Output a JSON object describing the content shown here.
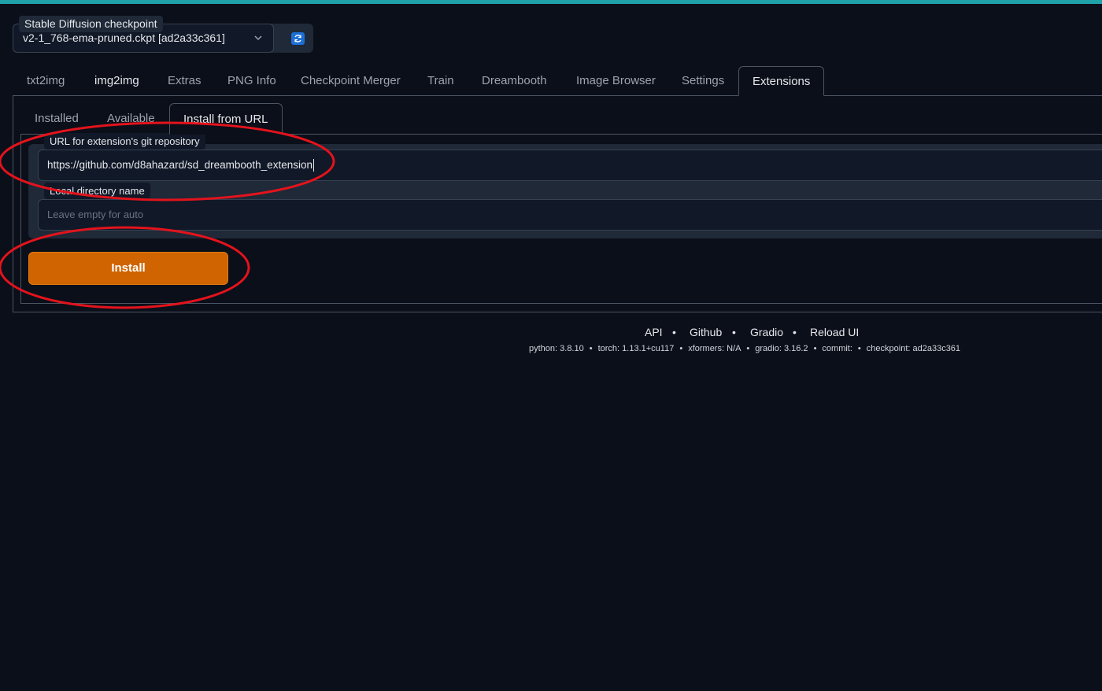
{
  "checkpoint": {
    "label": "Stable Diffusion checkpoint",
    "value": "v2-1_768-ema-pruned.ckpt [ad2a33c361]"
  },
  "main_tabs": [
    {
      "label": "txt2img"
    },
    {
      "label": "img2img"
    },
    {
      "label": "Extras"
    },
    {
      "label": "PNG Info"
    },
    {
      "label": "Checkpoint Merger"
    },
    {
      "label": "Train"
    },
    {
      "label": "Dreambooth"
    },
    {
      "label": "Image Browser"
    },
    {
      "label": "Settings"
    },
    {
      "label": "Extensions"
    }
  ],
  "active_main_tab": "Extensions",
  "sub_tabs": [
    {
      "label": "Installed"
    },
    {
      "label": "Available"
    },
    {
      "label": "Install from URL"
    }
  ],
  "active_sub_tab": "Install from URL",
  "form": {
    "url_label": "URL for extension's git repository",
    "url_value": "https://github.com/d8ahazard/sd_dreambooth_extension",
    "dir_label": "Local directory name",
    "dir_placeholder": "Leave empty for auto",
    "install_label": "Install"
  },
  "footer": {
    "links": [
      "API",
      "Github",
      "Gradio",
      "Reload UI"
    ],
    "separator": "•",
    "info": [
      "python: 3.8.10",
      "torch: 1.13.1+cu117",
      "xformers: N/A",
      "gradio: 3.16.2",
      "commit:",
      "checkpoint: ad2a33c361"
    ]
  },
  "colors": {
    "background": "#0b0f19",
    "accent_bar": "#1fa2a8",
    "install_button": "#cf6400",
    "annotation": "#e3131c"
  },
  "icons": {
    "dropdown": "chevron-down-icon",
    "refresh": "refresh-icon"
  }
}
